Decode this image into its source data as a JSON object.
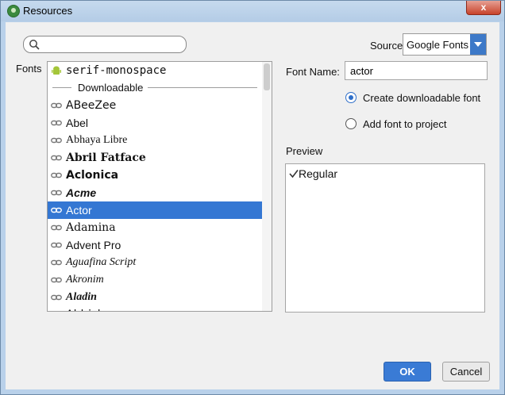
{
  "window": {
    "title": "Resources",
    "close_glyph": "x"
  },
  "search": {
    "value": "",
    "placeholder": ""
  },
  "source": {
    "label": "Source",
    "value": "Google Fonts"
  },
  "fonts_label": "Fonts",
  "font_list": {
    "items": [
      {
        "label": "serif-monospace",
        "icon": "android-icon",
        "family": "\"DejaVu Sans Mono\", monospace",
        "weight": "normal",
        "style": "normal"
      },
      {
        "label": "Downloadable",
        "type": "section"
      },
      {
        "label": "ABeeZee",
        "icon": "link-icon",
        "family": "\"DejaVu Sans\", sans-serif",
        "weight": "normal",
        "style": "normal"
      },
      {
        "label": "Abel",
        "icon": "link-icon",
        "family": "\"Liberation Sans\", sans-serif",
        "weight": "normal",
        "style": "normal"
      },
      {
        "label": "Abhaya Libre",
        "icon": "link-icon",
        "family": "\"Liberation Serif\", serif",
        "weight": "normal",
        "style": "normal"
      },
      {
        "label": "Abril Fatface",
        "icon": "link-icon",
        "family": "\"DejaVu Serif\", serif",
        "weight": "bold",
        "style": "normal"
      },
      {
        "label": "Aclonica",
        "icon": "link-icon",
        "family": "\"DejaVu Sans\", sans-serif",
        "weight": "bold",
        "style": "normal"
      },
      {
        "label": "Acme",
        "icon": "link-icon",
        "family": "\"Liberation Sans\", sans-serif",
        "weight": "bold",
        "style": "italic"
      },
      {
        "label": "Actor",
        "icon": "link-icon",
        "family": "\"Liberation Sans\", sans-serif",
        "weight": "normal",
        "style": "normal",
        "selected": true
      },
      {
        "label": "Adamina",
        "icon": "link-icon",
        "family": "\"DejaVu Serif\", serif",
        "weight": "normal",
        "style": "normal"
      },
      {
        "label": "Advent Pro",
        "icon": "link-icon",
        "family": "\"Liberation Sans\", sans-serif",
        "weight": "normal",
        "style": "normal"
      },
      {
        "label": "Aguafina Script",
        "icon": "link-icon",
        "family": "\"Liberation Serif\", serif",
        "weight": "normal",
        "style": "italic"
      },
      {
        "label": "Akronim",
        "icon": "link-icon",
        "family": "\"Liberation Serif\", serif",
        "weight": "normal",
        "style": "italic"
      },
      {
        "label": "Aladin",
        "icon": "link-icon",
        "family": "\"Liberation Serif\", serif",
        "weight": "bold",
        "style": "italic"
      },
      {
        "label": "Aldrich",
        "icon": "link-icon",
        "family": "\"DejaVu Sans\", sans-serif",
        "weight": "normal",
        "style": "normal"
      }
    ]
  },
  "font_name": {
    "label": "Font Name:",
    "value": "actor"
  },
  "options": {
    "downloadable": {
      "label": "Create downloadable font",
      "checked": true
    },
    "add_to_project": {
      "label": "Add font to project",
      "checked": false
    }
  },
  "preview": {
    "label": "Preview",
    "style_label": "Regular"
  },
  "buttons": {
    "ok": "OK",
    "cancel": "Cancel"
  },
  "colors": {
    "accent": "#3477d3",
    "selection": "#3477d3",
    "android_green": "#a4c639"
  }
}
